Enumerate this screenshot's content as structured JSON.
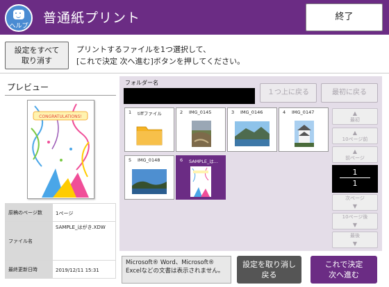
{
  "header": {
    "help_label": "ヘルプ",
    "title": "普通紙プリント",
    "end_label": "終了"
  },
  "toolbar": {
    "reset_line1": "設定をすべて",
    "reset_line2": "取り消す",
    "instruction_line1": "プリントするファイルを1つ選択して、",
    "instruction_line2": "[これで決定 次へ進む]ボタンを押してください。"
  },
  "preview": {
    "label": "プレビュー",
    "card_text": "CONGRATULATIONS!",
    "info": [
      {
        "key": "原稿のページ数",
        "value": "1ページ"
      },
      {
        "key": "ファイル名",
        "value": "SAMPLE_はがき.XDW"
      },
      {
        "key": "最終更新日時",
        "value": "2019/12/11 15:31"
      }
    ]
  },
  "browser": {
    "folder_label": "フォルダー名",
    "up_label": "１つ上に戻る",
    "top_label": "最初に戻る",
    "tiles": [
      {
        "num": "1",
        "name": "tiffファイル"
      },
      {
        "num": "2",
        "name": "IMG_0145"
      },
      {
        "num": "3",
        "name": "IMG_0146"
      },
      {
        "num": "4",
        "name": "IMG_0147"
      },
      {
        "num": "5",
        "name": "IMG_0148"
      },
      {
        "num": "6",
        "name": "SAMPLE_は..."
      }
    ],
    "side": {
      "first": "最初",
      "back10": "10ページ前",
      "prev": "前ページ",
      "next": "次ページ",
      "fwd10": "10ページ後",
      "last": "最後"
    },
    "page_current": "1",
    "page_total": "1"
  },
  "footer": {
    "note": "Microsoft® Word、Microsoft® Excelなどの文書は表示されません。",
    "cancel_line1": "設定を取り消し",
    "cancel_line2": "戻る",
    "confirm_line1": "これで決定",
    "confirm_line2": "次へ進む"
  },
  "colors": {
    "brand": "#6b2c84",
    "help": "#4a8bd2",
    "panel": "#e4dde8"
  }
}
